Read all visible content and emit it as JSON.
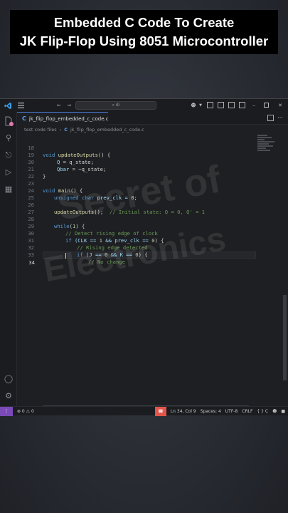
{
  "caption": {
    "line1": "Embedded C Code To Create",
    "line2": "JK Flip-Flop Using 8051 Microcontroller"
  },
  "titlebar": {
    "search_placeholder": "⌕ di"
  },
  "tab": {
    "label": "jk_flip_flop_embedded_c_code.c"
  },
  "breadcrumb": {
    "folder": "test code files",
    "file": "jk_flip_flop_embedded_c_code.c"
  },
  "code_lines": [
    {
      "n": "18"
    },
    {
      "n": "19"
    },
    {
      "n": "20"
    },
    {
      "n": "21"
    },
    {
      "n": "22"
    },
    {
      "n": "23"
    },
    {
      "n": "24"
    },
    {
      "n": "25"
    },
    {
      "n": "26"
    },
    {
      "n": "27"
    },
    {
      "n": "28"
    },
    {
      "n": "29"
    },
    {
      "n": "30"
    },
    {
      "n": "31"
    },
    {
      "n": "32"
    },
    {
      "n": "33"
    },
    {
      "n": "34"
    }
  ],
  "code": {
    "l18_kw": "void",
    "l18_fn": "updateOutputs",
    "l18_rest": "() {",
    "l19_var": "Q",
    "l19_rest": " = q_state;",
    "l20_var": "Qbar",
    "l20_rest": " = ~q_state;",
    "l21": "}",
    "l23_kw": "void",
    "l23_fn": "main",
    "l23_rest": "() {",
    "l24_kw": "unsigned char",
    "l24_rest": " prev_clk = ",
    "l24_num": "0",
    "l24_end": ";",
    "l26_fn": "updateOutputs",
    "l26_rest": "();  ",
    "l26_cm": "// Initial state: Q = 0, Q' = 1",
    "l28_kw": "while",
    "l28_rest": "(",
    "l28_num": "1",
    "l28_end": ") {",
    "l29_cm": "// Detect rising edge of clock",
    "l30_kw": "if",
    "l30_rest": " (CLK == ",
    "l30_num1": "1",
    "l30_mid": " && prev_clk == ",
    "l30_num2": "0",
    "l30_end": ") {",
    "l31_cm": "// Rising edge detected",
    "l32_kw": "if",
    "l32_rest": " (J == ",
    "l32_num1": "0",
    "l32_mid": " && K == ",
    "l32_num2": "0",
    "l32_end": ") {",
    "l33_cm": "// No change"
  },
  "watermark": {
    "line1": "Secret of",
    "line2": "Electronics"
  },
  "statusbar": {
    "problems": "⊗ 0 ⚠ 0",
    "position": "Ln 34, Col 9",
    "spaces": "Spaces: 4",
    "encoding": "UTF-8",
    "eol": "CRLF",
    "language": "{ } C"
  },
  "colors": {
    "accent": "#4d7bd6",
    "remote": "#7a4ab8",
    "alert": "#e2554a"
  }
}
